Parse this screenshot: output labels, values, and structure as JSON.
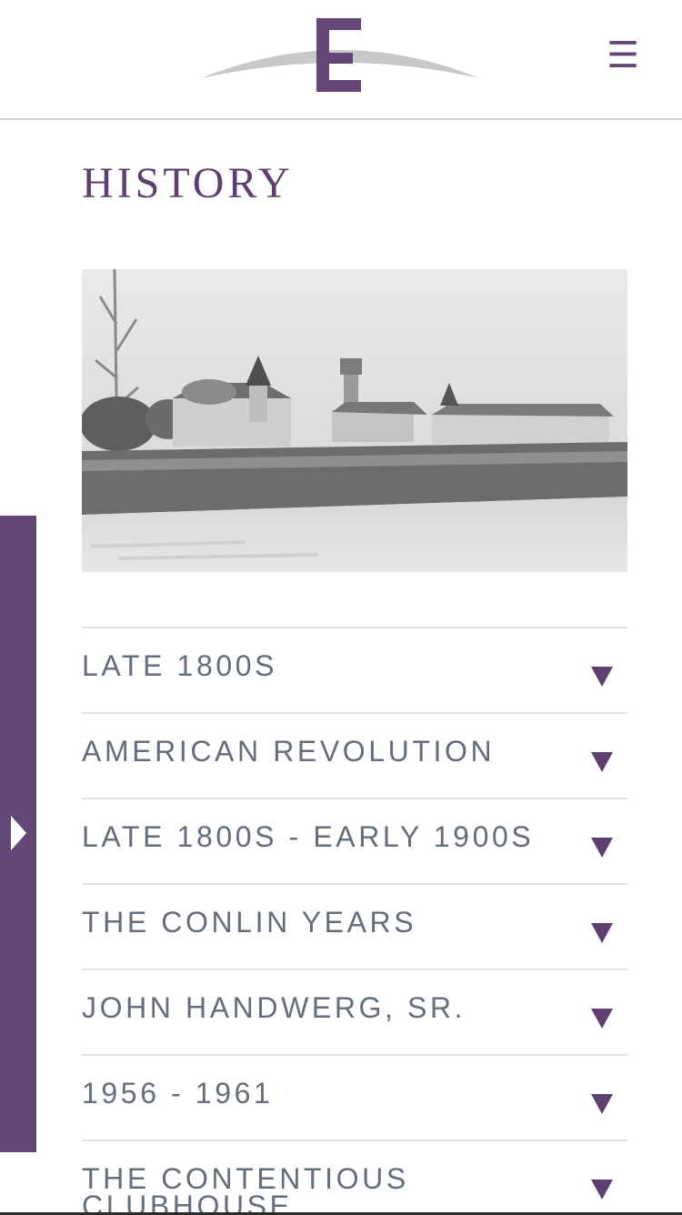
{
  "header": {
    "logo_alt": "logo-icon",
    "menu_icon": "hamburger-icon",
    "menu_glyph": "☰"
  },
  "page_title": "HISTORY",
  "hero": {
    "image": "historic-hotel-photo"
  },
  "side_tab": {
    "icon": "play-arrow-icon"
  },
  "accordion": {
    "caret_icon": "caret-down-icon",
    "items": [
      {
        "label": "LATE 1800S"
      },
      {
        "label": "AMERICAN REVOLUTION"
      },
      {
        "label": "LATE 1800S - EARLY 1900S"
      },
      {
        "label": "THE CONLIN YEARS"
      },
      {
        "label": "JOHN HANDWERG, SR."
      },
      {
        "label": "1956 - 1961"
      },
      {
        "label": "THE CONTENTIOUS CLUBHOUSE"
      }
    ]
  },
  "colors": {
    "brand_purple": "#644677",
    "title_purple": "#5e3f6f",
    "label_gray": "#636d7b",
    "divider": "#e3e3e5"
  }
}
